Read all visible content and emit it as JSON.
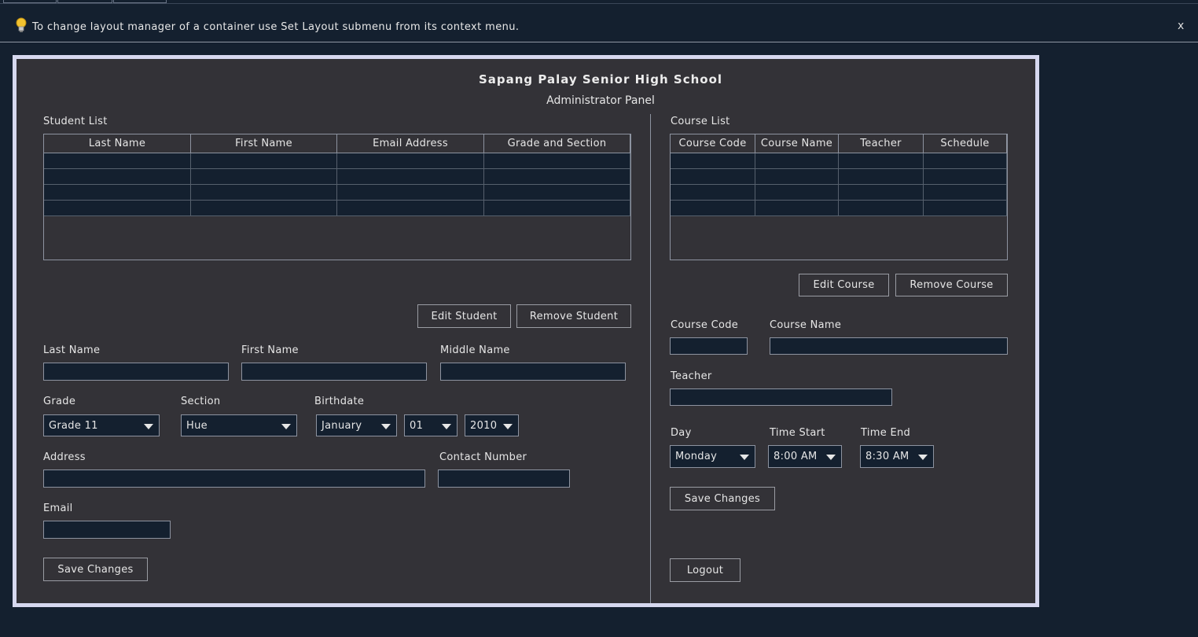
{
  "hint": {
    "text": "To change layout manager of a container use Set Layout submenu from its context menu.",
    "close_label": "x",
    "icon": "lightbulb-icon"
  },
  "header": {
    "school_name": "Sapang Palay Senior High School",
    "panel_title": "Administrator Panel"
  },
  "students": {
    "section_label": "Student List",
    "columns": [
      "Last Name",
      "First Name",
      "Email Address",
      "Grade and Section"
    ],
    "empty_rows": 4,
    "edit_button": "Edit Student",
    "remove_button": "Remove Student",
    "form": {
      "last_name_label": "Last Name",
      "first_name_label": "First Name",
      "middle_name_label": "Middle Name",
      "grade_label": "Grade",
      "grade_value": "Grade 11",
      "section_label": "Section",
      "section_value": "Hue",
      "birthdate_label": "Birthdate",
      "birth_month": "January",
      "birth_day": "01",
      "birth_year": "2010",
      "address_label": "Address",
      "contact_label": "Contact Number",
      "email_label": "Email",
      "save_button": "Save Changes"
    }
  },
  "courses": {
    "section_label": "Course List",
    "columns": [
      "Course Code",
      "Course Name",
      "Teacher",
      "Schedule"
    ],
    "empty_rows": 4,
    "edit_button": "Edit Course",
    "remove_button": "Remove Course",
    "form": {
      "code_label": "Course Code",
      "name_label": "Course Name",
      "teacher_label": "Teacher",
      "day_label": "Day",
      "day_value": "Monday",
      "time_start_label": "Time Start",
      "time_start_value": "8:00 AM",
      "time_end_label": "Time End",
      "time_end_value": "8:30 AM",
      "save_button": "Save Changes"
    },
    "logout_button": "Logout"
  },
  "colors": {
    "background": "#14202f",
    "panel": "#333237",
    "frame": "#d6d8ef"
  }
}
